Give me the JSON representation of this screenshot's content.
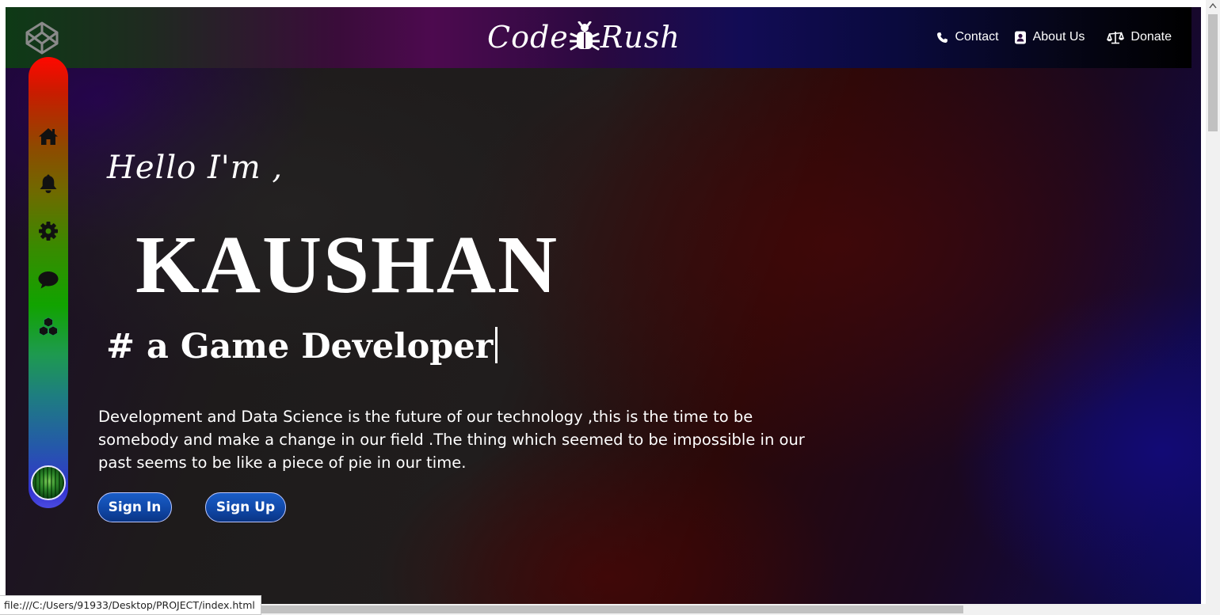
{
  "navbar": {
    "brand_left": "Code",
    "brand_right": "Rush",
    "links": [
      {
        "label": "Contact",
        "icon": "phone-icon"
      },
      {
        "label": "About Us",
        "icon": "contact-card-icon"
      },
      {
        "label": "Donate",
        "icon": "scale-icon"
      }
    ]
  },
  "sidebar": {
    "items": [
      {
        "name": "home",
        "icon": "home-icon"
      },
      {
        "name": "notifications",
        "icon": "bell-icon"
      },
      {
        "name": "settings",
        "icon": "gear-icon"
      },
      {
        "name": "messages",
        "icon": "chat-icon"
      },
      {
        "name": "projects",
        "icon": "cubes-icon"
      }
    ],
    "avatar": "user-avatar"
  },
  "hero": {
    "greeting": "Hello I'm ,",
    "name": "KAUSHAN",
    "role": "# a Game Developer",
    "description": "Development and Data Science is the future of our technology ,this is the time to be somebody and make a change in our field .The thing which seemed to be impossible in our past seems to be like a piece of pie in our time.",
    "signin_label": "Sign In",
    "signup_label": "Sign Up"
  },
  "status_bar": {
    "url": "file:///C:/Users/91933/Desktop/PROJECT/index.html"
  },
  "colors": {
    "button_blue": "#1048a8",
    "sidebar_top": "#ff0800",
    "sidebar_mid": "#11a300",
    "sidebar_bottom": "#4a4ae0"
  }
}
